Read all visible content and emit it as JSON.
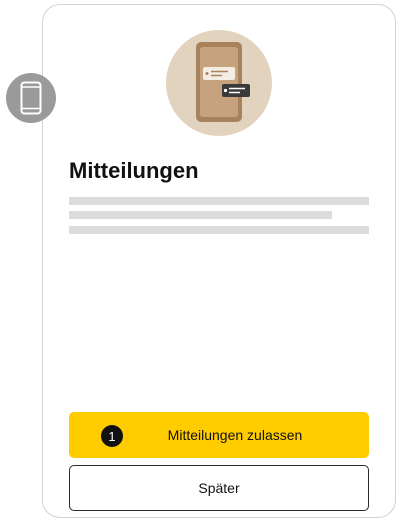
{
  "dialog": {
    "title": "Mitteilungen",
    "primary_button": {
      "label": "Mitteilungen zulassen",
      "step_number": "1"
    },
    "secondary_button": {
      "label": "Später"
    }
  },
  "icons": {
    "side_badge": "smartphone-icon",
    "hero": "phone-notification-illustration"
  },
  "colors": {
    "primary": "#ffcc00",
    "hero_background": "#e2d3bf",
    "badge_background": "#9a9a9a"
  }
}
